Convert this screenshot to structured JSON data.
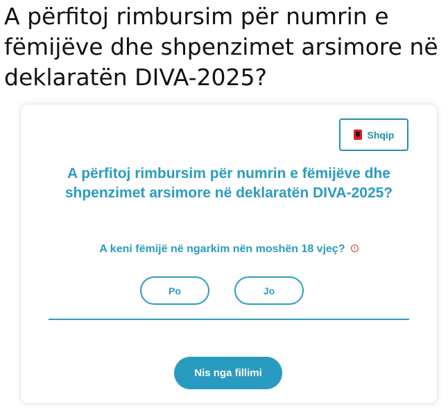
{
  "page": {
    "heading": "A përfitoj rimbursim për numrin e fëmijëve dhe shpenzimet arsimore në deklaratën DIVA-2025?"
  },
  "card": {
    "language": {
      "label": "Shqip",
      "flag_icon": "albania-flag-icon"
    },
    "title": "A përfitoj rimbursim për numrin e fëmijëve dhe shpenzimet arsimore në deklaratën DIVA-2025?",
    "question": {
      "text": "A keni fëmijë në ngarkim nën moshën 18 vjeç?",
      "info_icon": "info-icon"
    },
    "answers": {
      "yes_label": "Po",
      "no_label": "Jo"
    },
    "restart_label": "Nis nga fillimi"
  },
  "colors": {
    "accent": "#2a9bc0",
    "info_icon": "#c0392b"
  }
}
